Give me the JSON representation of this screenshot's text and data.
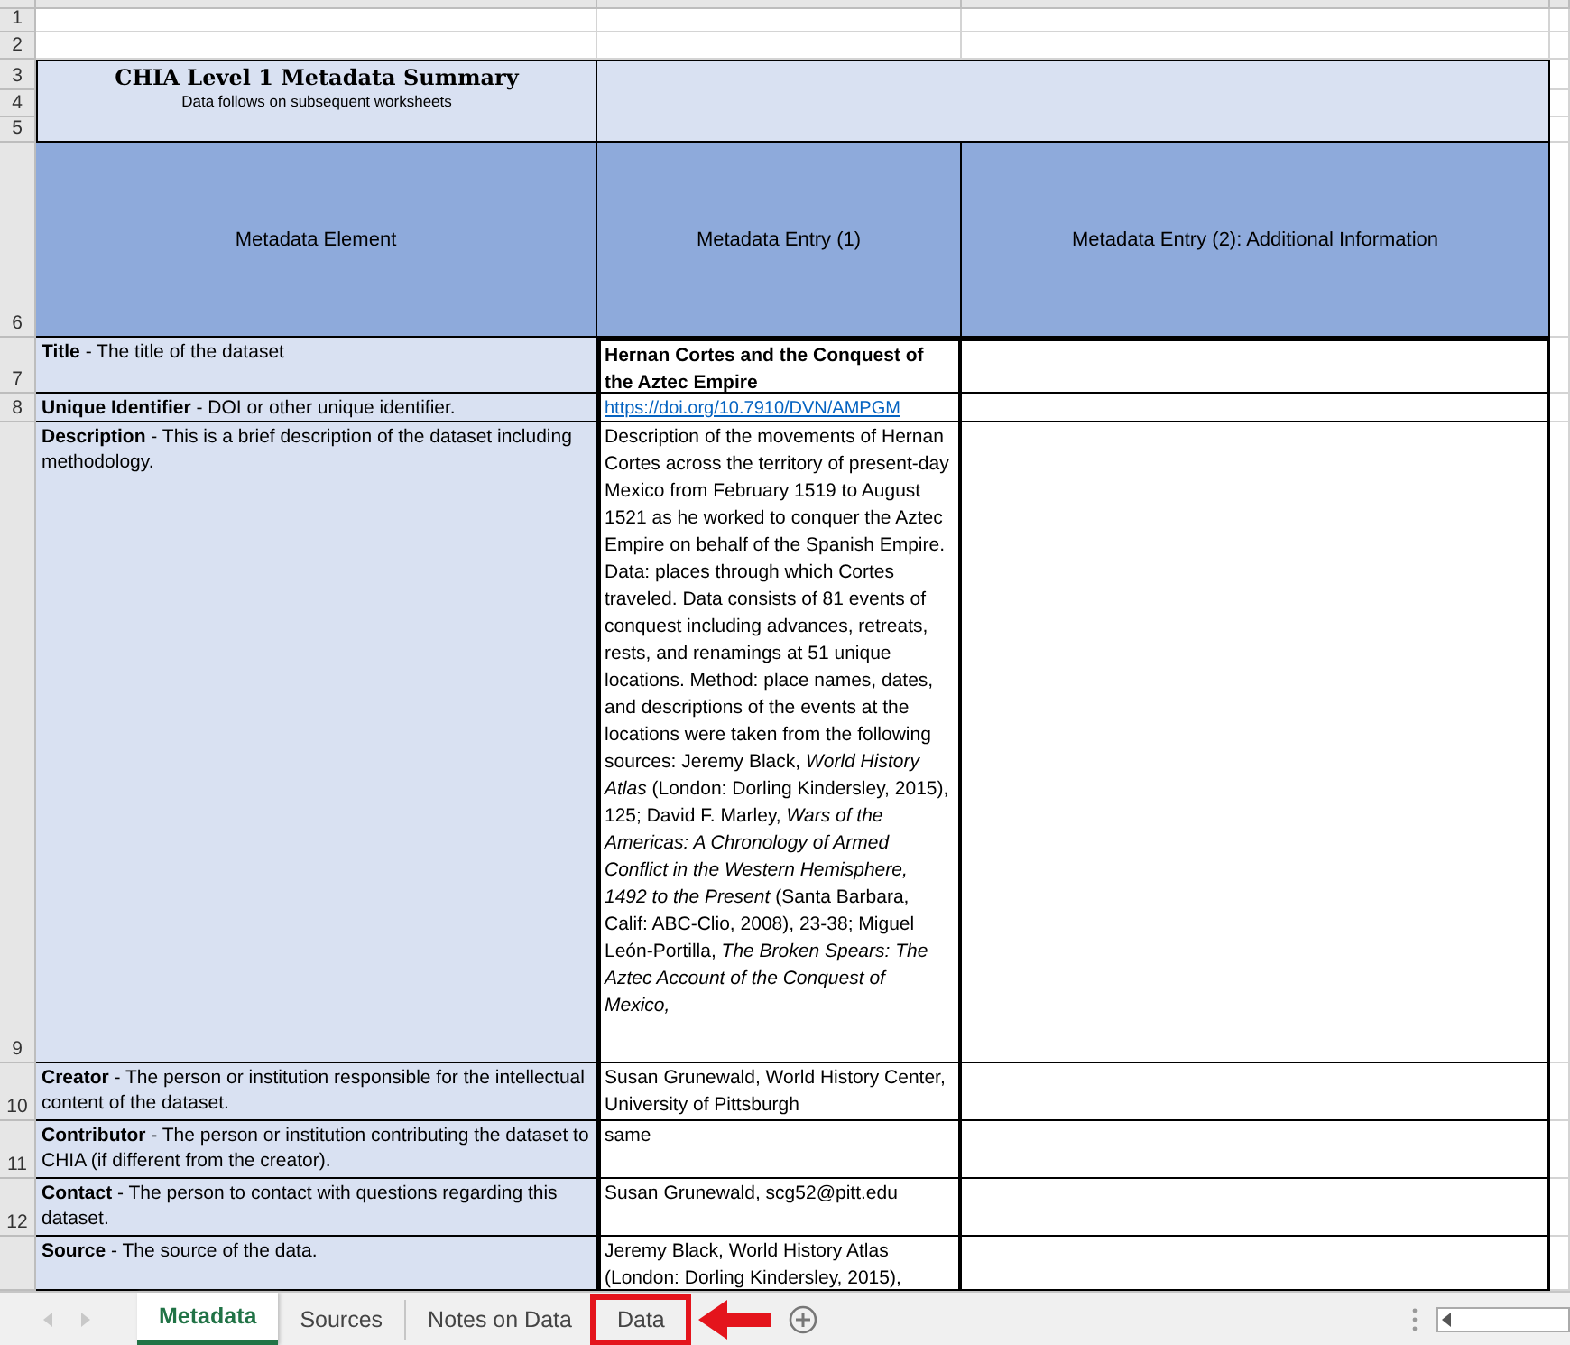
{
  "title_block": {
    "title": "CHIA Level 1 Metadata Summary",
    "subtitle": "Data follows on subsequent worksheets"
  },
  "row_numbers": [
    "1",
    "2",
    "3",
    "4",
    "5",
    "6",
    "7",
    "8",
    "9",
    "10",
    "11",
    "12"
  ],
  "header": [
    "Metadata Element",
    "Metadata Entry (1)",
    "Metadata Entry (2): Additional Information"
  ],
  "rows": [
    {
      "element": "**Title** - The title of the dataset",
      "entry_1": "Hernan Cortes and the Conquest of the Aztec Empire",
      "kind": "bold"
    },
    {
      "element": "**Unique Identifier** - DOI or other unique identifier.",
      "entry_1": "https://doi.org/10.7910/DVN/AMPGM",
      "kind": "link"
    },
    {
      "element": "**Description** - This is a brief description of the dataset including methodology.",
      "entry_1": "Description of the movements of Hernan Cortes across the territory of present-day Mexico from February 1519 to August 1521 as he worked to conquer the Aztec Empire on behalf of the Spanish Empire. Data: places through which Cortes traveled. Data consists of 81 events of conquest including advances, retreats, rests, and renamings at 51 unique locations. Method: place names, dates, and descriptions of the events at the locations were taken from the following sources: Jeremy Black, *World History Atlas*  (London: Dorling Kindersley, 2015), 125; David F. Marley, *Wars of the Americas: A Chronology of Armed Conflict in the Western Hemisphere, 1492 to the Present*  (Santa Barbara, Calif: ABC-Clio, 2008), 23-38; Miguel León-Portilla, *The Broken Spears: The Aztec Account of the Conquest of Mexico,*",
      "kind": "text"
    },
    {
      "element": "**Creator** - The person or institution responsible for the intellectual content of the dataset.",
      "entry_1": "Susan Grunewald, World History Center, University of Pittsburgh",
      "kind": "text"
    },
    {
      "element": "**Contributor** - The person or institution contributing the dataset to CHIA (if different from the creator).",
      "entry_1": "same",
      "kind": "text"
    },
    {
      "element": "**Contact** - The person to contact with questions regarding this dataset.",
      "entry_1": "Susan Grunewald, scg52@pitt.edu",
      "kind": "text"
    },
    {
      "element": "**Source** - The source of the data.",
      "entry_1": "Jeremy Black, World History Atlas (London: Dorling Kindersley, 2015),",
      "kind": "text"
    }
  ],
  "tabs": [
    {
      "label": "Metadata",
      "selected": true,
      "highlighted": false
    },
    {
      "label": "Sources",
      "selected": false,
      "highlighted": false
    },
    {
      "label": "Notes on Data",
      "selected": false,
      "highlighted": false
    },
    {
      "label": "Data",
      "selected": false,
      "highlighted": true
    }
  ]
}
